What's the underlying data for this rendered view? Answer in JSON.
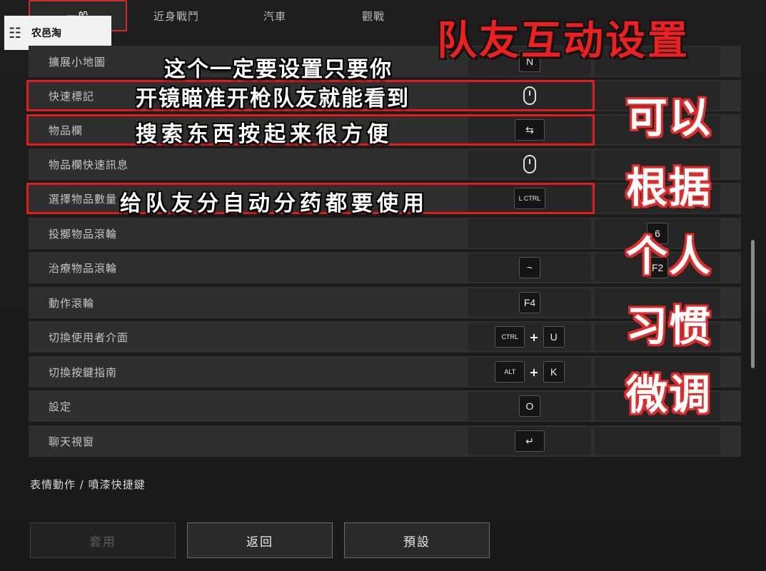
{
  "tabs": [
    {
      "label": "一般"
    },
    {
      "label": "近身戰鬥"
    },
    {
      "label": "汽車"
    },
    {
      "label": "觀戰"
    }
  ],
  "watermark": {
    "logo": "☷",
    "text": "农邑淘"
  },
  "rows": [
    {
      "label": "擴展小地圖",
      "key1": "N",
      "key2": ""
    },
    {
      "label": "快速標記",
      "key1": "mouse-middle",
      "key2": ""
    },
    {
      "label": "物品欄",
      "key1": "⇆",
      "key2": ""
    },
    {
      "label": "物品欄快速訊息",
      "key1": "mouse-middle",
      "key2": ""
    },
    {
      "label": "選擇物品數量",
      "key1": "L CTRL",
      "key2": ""
    },
    {
      "label": "投擲物品滾輪",
      "key1": "",
      "key2": "6"
    },
    {
      "label": "治療物品滾輪",
      "key1": "~",
      "key2": "F2"
    },
    {
      "label": "動作滾輪",
      "key1": "F4",
      "key2": ""
    },
    {
      "label": "切換使用者介面",
      "key1a": "CTRL",
      "plus": "+",
      "key1b": "U",
      "key2": ""
    },
    {
      "label": "切換按鍵指南",
      "key1a": "ALT",
      "plus": "+",
      "key1b": "K",
      "key2": ""
    },
    {
      "label": "設定",
      "key1": "O",
      "key2": ""
    },
    {
      "label": "聊天視窗",
      "key1": "↵",
      "key2": ""
    }
  ],
  "overlay": {
    "title": "队友互动设置",
    "caption1": "这个一定要设置只要你",
    "caption2": "开镜瞄准开枪队友就能看到",
    "caption3": "搜索东西按起来很方便",
    "caption4": "给队友分自动分药都要使用",
    "side": [
      "可以",
      "根据",
      "个人",
      "习惯",
      "微调"
    ]
  },
  "section_title": "表情動作 / 噴漆快捷鍵",
  "buttons": {
    "apply": "套用",
    "back": "返回",
    "default": "預設"
  },
  "colors": {
    "highlight": "#e21d1d",
    "title_red": "#ee1f1f",
    "row_bg": "#2f2f2f"
  }
}
